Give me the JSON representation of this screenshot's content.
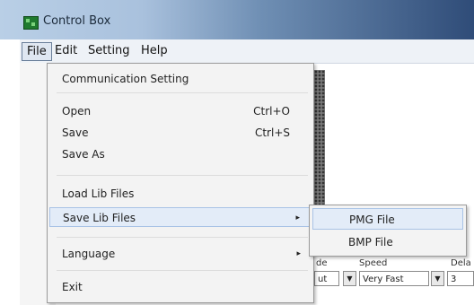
{
  "window": {
    "title": "Control Box"
  },
  "menubar": {
    "items": [
      "File",
      "Edit",
      "Setting",
      "Help"
    ]
  },
  "file_menu": {
    "items": [
      {
        "label": "Communication Setting",
        "shortcut": ""
      },
      {
        "label": "Open",
        "shortcut": "Ctrl+O"
      },
      {
        "label": "Save",
        "shortcut": "Ctrl+S"
      },
      {
        "label": "Save As",
        "shortcut": ""
      },
      {
        "label": "Load Lib Files",
        "shortcut": ""
      },
      {
        "label": "Save Lib Files",
        "shortcut": "",
        "submenu": true,
        "highlighted": true
      },
      {
        "label": "Language",
        "shortcut": "",
        "submenu": true
      },
      {
        "label": "Exit",
        "shortcut": ""
      }
    ]
  },
  "save_lib_submenu": {
    "items": [
      "PMG File",
      "BMP File"
    ]
  },
  "background_panel": {
    "columns": {
      "mode": "de",
      "speed": "Speed",
      "delay": "Dela"
    },
    "mode_value": "ut",
    "speed_value": "Very Fast",
    "delay_value": "3"
  },
  "icons": {
    "submenu_arrow": "▸",
    "dropdown_arrow": "▼"
  },
  "colors": {
    "menu_bg": "#f3f3f3",
    "highlight_bg": "#e3ecf8",
    "highlight_border": "#a9c3e6"
  }
}
